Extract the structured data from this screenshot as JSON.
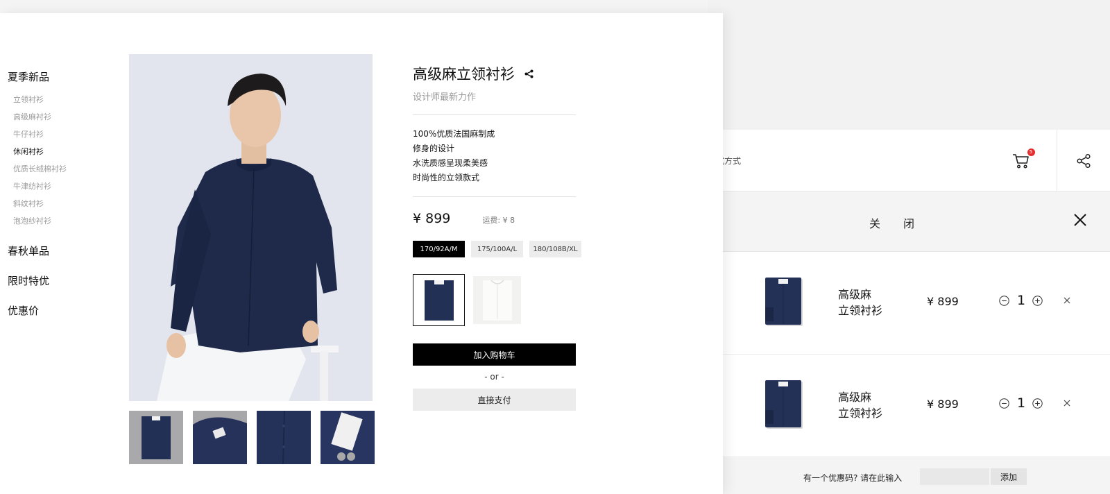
{
  "nav": {
    "categories": [
      {
        "label": "夏季新品",
        "items": [
          "立领衬衫",
          "高级麻衬衫",
          "牛仔衬衫",
          "休闲衬衫",
          "优质长绒棉衬衫",
          "牛津纺衬衫",
          "斜纹衬衫",
          "泡泡纱衬衫"
        ],
        "active_item": "休闲衬衫"
      },
      {
        "label": "春秋单品"
      },
      {
        "label": "限时特优"
      },
      {
        "label": "优惠价"
      }
    ]
  },
  "product": {
    "title": "高级麻立领衬衫",
    "subtitle": "设计师最新力作",
    "features": [
      "100%优质法国麻制成",
      "修身的设计",
      "水洗质感呈现柔美感",
      "时尚性的立领款式"
    ],
    "price": "¥ 899",
    "shipping": "运费: ¥ 8",
    "sizes": [
      "170/92A/M",
      "175/100A/L",
      "180/108B/XL"
    ],
    "selected_size": "170/92A/M",
    "colors": [
      "navy",
      "white"
    ],
    "selected_color": "navy",
    "add_to_cart_label": "加入购物车",
    "or_label": "-  or  -",
    "buy_now_label": "直接支付"
  },
  "drawer": {
    "header_partial_text": "式方式",
    "cart_badge_count": "5",
    "close_label": "关 闭",
    "items": [
      {
        "name_line1": "高级麻",
        "name_line2": "立领衬衫",
        "price": "¥ 899",
        "quantity": "1"
      },
      {
        "name_line1": "高级麻",
        "name_line2": "立领衬衫",
        "price": "¥ 899",
        "quantity": "1"
      }
    ],
    "coupon_label": "有一个优惠码? 请在此输入",
    "coupon_placeholder": "",
    "coupon_button": "添加"
  },
  "colors": {
    "accent": "#000000",
    "badge": "#e62e2e",
    "shirt_navy": "#1f2a4a",
    "muted_text": "#9a9a9a"
  }
}
